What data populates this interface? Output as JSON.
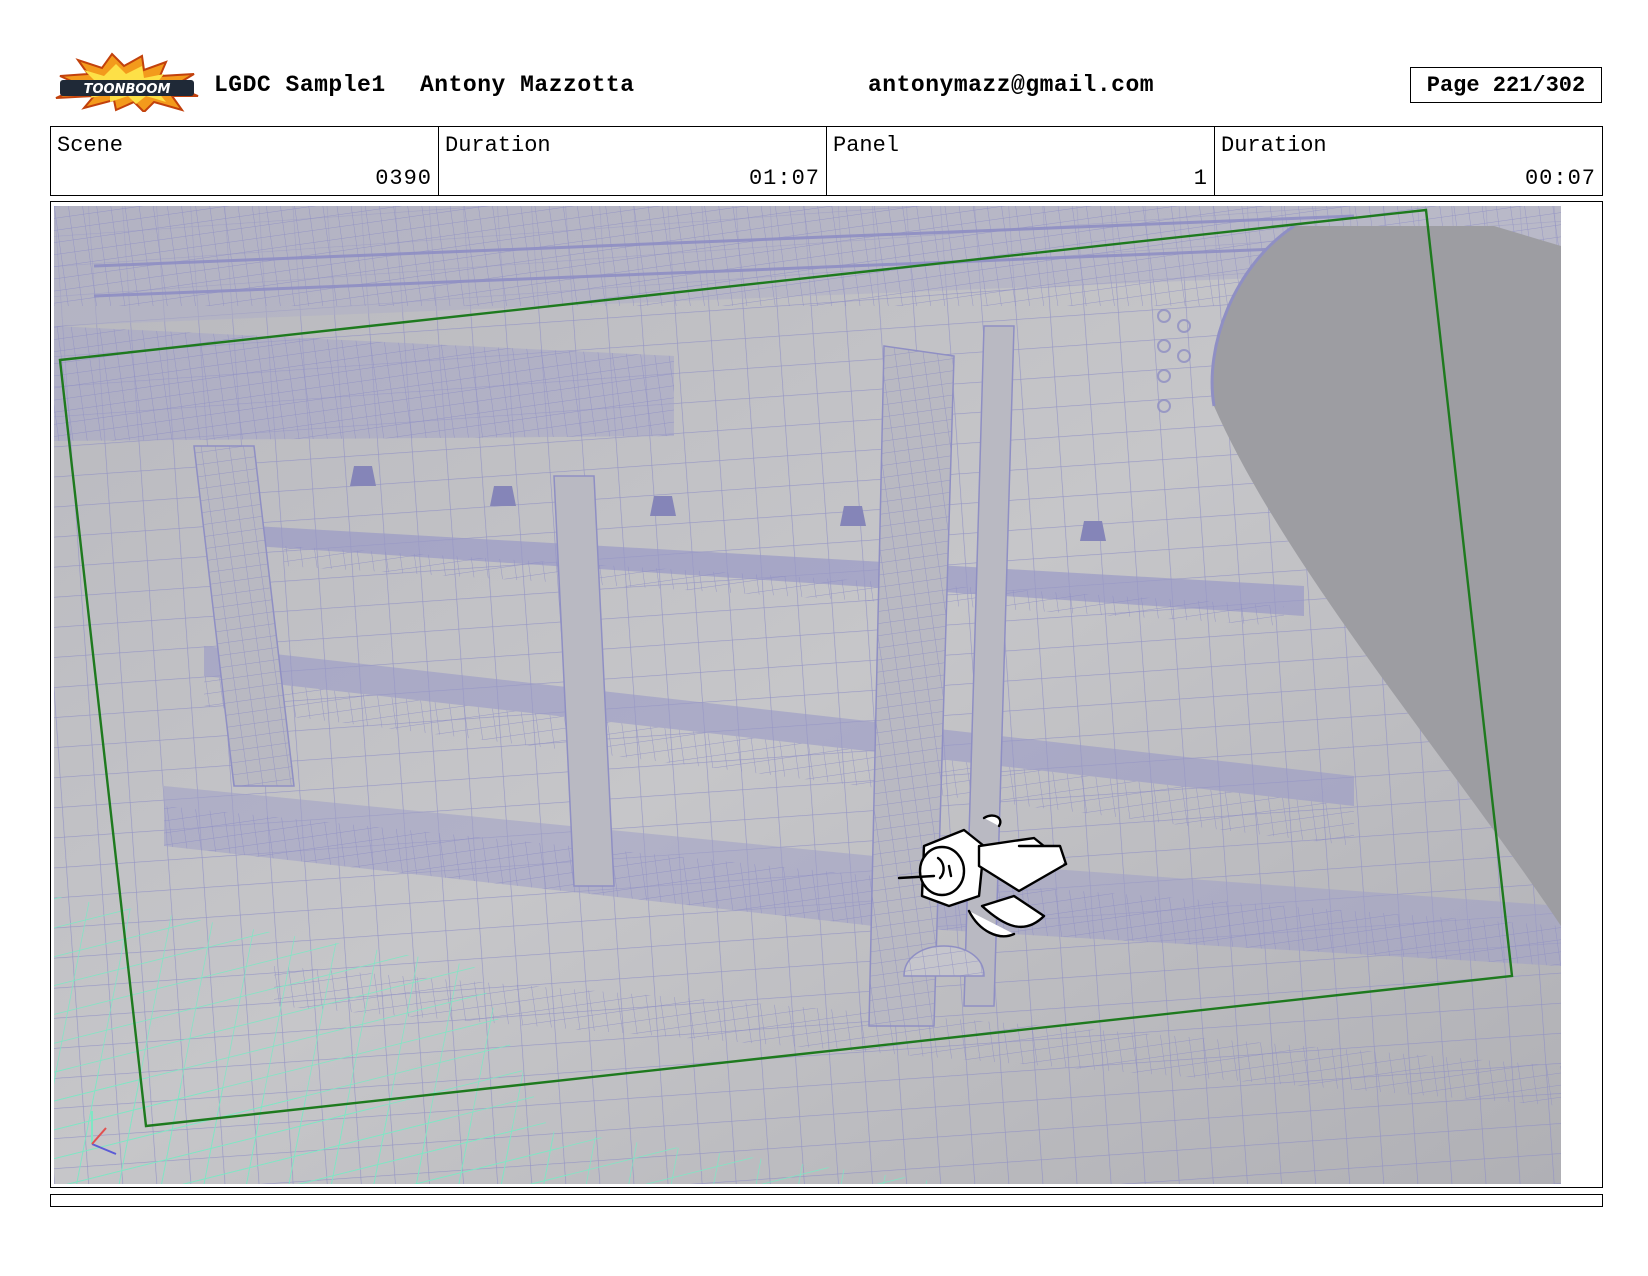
{
  "header": {
    "logo_text": "TOONBOOM",
    "project": "LGDC Sample1",
    "author": "Antony Mazzotta",
    "email": "antonymazz@gmail.com",
    "page": "Page 221/302"
  },
  "info": {
    "scene_label": "Scene",
    "scene_value": "0390",
    "scene_duration_label": "Duration",
    "scene_duration_value": "01:07",
    "panel_label": "Panel",
    "panel_value": "1",
    "panel_duration_label": "Duration",
    "panel_duration_value": "00:07"
  },
  "panel": {
    "frame_color": "#1e7a1e",
    "wire_color": "#8f8fc4",
    "floor_grid_color": "#7fe6c4"
  }
}
